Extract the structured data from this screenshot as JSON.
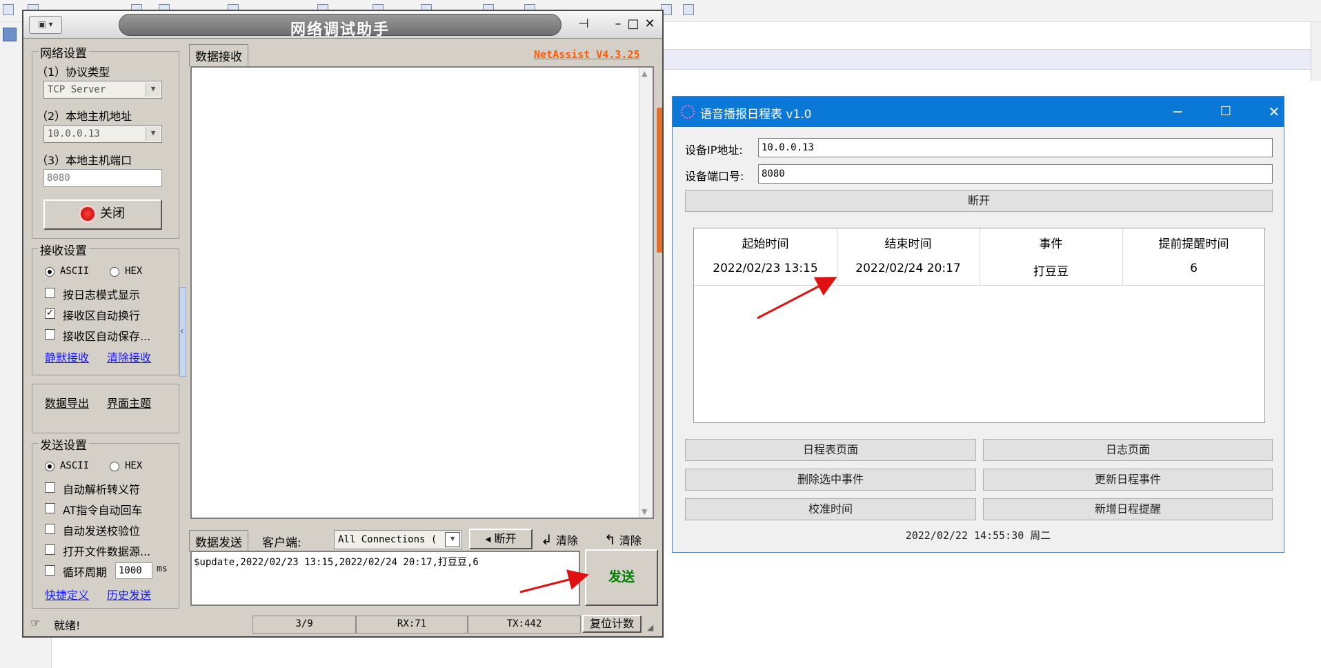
{
  "netassist": {
    "title": "网络调试助手",
    "version": "NetAssist V4.3.25",
    "net_settings": {
      "group_title": "网络设置",
      "protocol_label": "（1）协议类型",
      "protocol_value": "TCP Server",
      "host_label": "（2）本地主机地址",
      "host_value": "10.0.0.13",
      "port_label": "（3）本地主机端口",
      "port_value": "8080",
      "close_button": "关闭"
    },
    "recv_settings": {
      "group_title": "接收设置",
      "ascii": "ASCII",
      "hex": "HEX",
      "log_mode": "按日志模式显示",
      "auto_wrap": "接收区自动换行",
      "auto_save": "接收区自动保存...",
      "silent_recv": "静默接收",
      "clear_recv": "清除接收"
    },
    "misc": {
      "data_export": "数据导出",
      "ui_theme": "界面主题"
    },
    "send_settings": {
      "group_title": "发送设置",
      "ascii": "ASCII",
      "hex": "HEX",
      "parse_escape": "自动解析转义符",
      "at_cr": "AT指令自动回车",
      "checksum": "自动发送校验位",
      "open_file": "打开文件数据源...",
      "loop_period": "循环周期",
      "loop_value": "1000",
      "loop_unit": "ms",
      "shortcut": "快捷定义",
      "history": "历史发送"
    },
    "recv_tab": "数据接收",
    "send_tab": "数据发送",
    "client_label": "客户端:",
    "client_value": "All Connections (",
    "disconnect_button": "断开",
    "clear_button_1": "清除",
    "clear_button_2": "清除",
    "send_text": "$update,2022/02/23 13:15,2022/02/24 20:17,打豆豆,6",
    "send_button": "发送",
    "status": {
      "ready": "就绪!",
      "count": "3/9",
      "rx": "RX:71",
      "tx": "TX:442",
      "reset": "复位计数"
    }
  },
  "schedule": {
    "title": "语音播报日程表 v1.0",
    "ip_label": "设备IP地址:",
    "ip_value": "10.0.0.13",
    "port_label": "设备端口号:",
    "port_value": "8080",
    "disconnect_button": "断开",
    "columns": [
      "起始时间",
      "结束时间",
      "事件",
      "提前提醒时间"
    ],
    "rows": [
      [
        "2022/02/23 13:15",
        "2022/02/24 20:17",
        "打豆豆",
        "6"
      ]
    ],
    "buttons": {
      "schedule_page": "日程表页面",
      "log_page": "日志页面",
      "delete_event": "删除选中事件",
      "update_event": "更新日程事件",
      "calibrate_time": "校准时间",
      "add_reminder": "新增日程提醒"
    },
    "datetime": "2022/02/22 14:55:30 周二"
  },
  "colors": {
    "schedule_titlebar": "#0a78d7",
    "version_link": "#ff5a00",
    "send_button_text": "#008000",
    "annotation_arrow": "#e01010"
  }
}
